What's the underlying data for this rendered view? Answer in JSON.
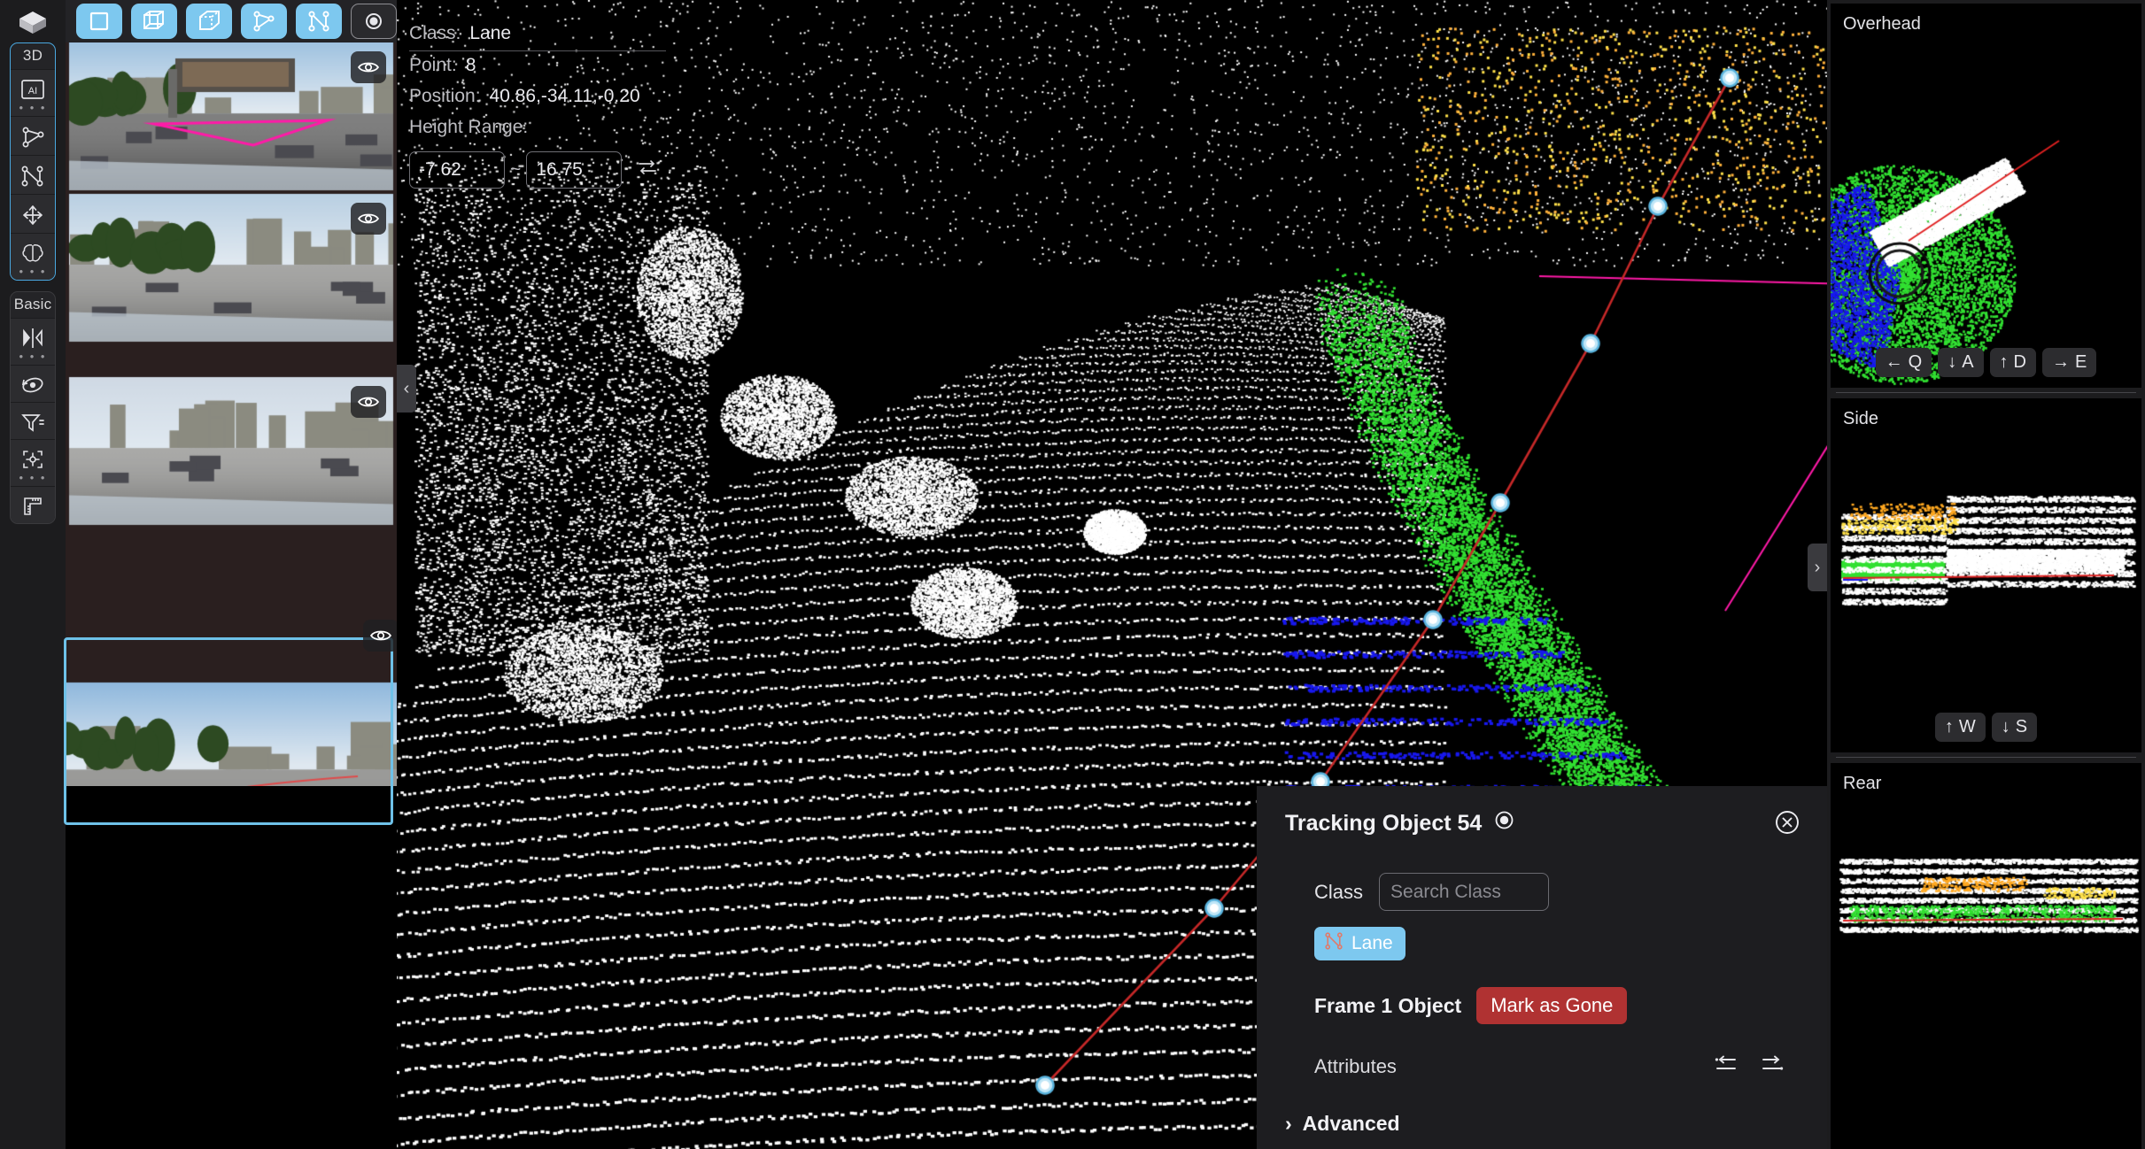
{
  "app": {
    "name": "3d-lidar-annotation-tool"
  },
  "rail": {
    "logo_icon": "cube-logo-icon",
    "groups": [
      {
        "header": "3D",
        "active": true,
        "items": [
          {
            "icon": "ai-box-icon",
            "name": "ai-tool",
            "more": true
          },
          {
            "icon": "polygon-icon",
            "name": "polygon-tool",
            "more": false
          },
          {
            "icon": "polyline-icon",
            "name": "polyline-tool",
            "more": false
          },
          {
            "icon": "move-icon",
            "name": "move-tool",
            "more": false
          },
          {
            "icon": "brain-icon",
            "name": "smart-tool",
            "more": true
          }
        ]
      },
      {
        "header": "Basic",
        "active": false,
        "items": [
          {
            "icon": "mirror-icon",
            "name": "mirror-tool",
            "more": true
          },
          {
            "icon": "rotate-icon",
            "name": "rotate-tool",
            "more": false
          },
          {
            "icon": "filter-icon",
            "name": "filter-tool",
            "more": false
          },
          {
            "icon": "crosshair-icon",
            "name": "focus-tool",
            "more": true
          },
          {
            "icon": "ruler-icon",
            "name": "measure-tool",
            "more": false
          }
        ]
      }
    ]
  },
  "toolbar": {
    "items": [
      {
        "icon": "rect-2d-icon",
        "name": "tool-rect-2d",
        "active": true
      },
      {
        "icon": "cuboid-icon",
        "name": "tool-cuboid",
        "active": true
      },
      {
        "icon": "cuboid-solid-icon",
        "name": "tool-cuboid-solid",
        "active": true
      },
      {
        "icon": "polygon-icon",
        "name": "tool-polygon",
        "active": true
      },
      {
        "icon": "polyline-icon",
        "name": "tool-polyline",
        "active": true
      },
      {
        "icon": "point-icon",
        "name": "tool-point",
        "active": false
      }
    ]
  },
  "cameras": [
    {
      "name": "camera-front",
      "eye_icon": "eye-icon",
      "selected": false
    },
    {
      "name": "camera-front-left",
      "eye_icon": "eye-icon",
      "selected": false
    },
    {
      "name": "camera-front-right",
      "eye_icon": "eye-icon",
      "selected": false
    },
    {
      "name": "camera-rear",
      "eye_icon": "eye-icon",
      "selected": true
    }
  ],
  "info": {
    "class_label": "Class:",
    "class_value": "Lane",
    "point_label": "Point:",
    "point_value": "8",
    "position_label": "Position:",
    "position_value": "40.86,-34.11,-0.20",
    "height_range_label": "Height Range:",
    "height_min": "-7.62",
    "height_max": "16.75",
    "range_separator": "~",
    "swap_icon": "swap-range-icon"
  },
  "handles": {
    "left_icon": "chevron-left-icon",
    "left_glyph": "‹",
    "right_icon": "chevron-right-icon",
    "right_glyph": "›"
  },
  "tracking_panel": {
    "title": "Tracking Object 54",
    "visibility_icon": "eye-target-icon",
    "close_icon": "close-icon",
    "class_label": "Class",
    "class_placeholder": "Search Class",
    "class_value": "",
    "chip_label": "Lane",
    "chip_icon": "polyline-icon",
    "chip_color": "#7dc8ef",
    "frame_label": "Frame 1 Object",
    "mark_gone_label": "Mark as Gone",
    "mark_gone_color": "#b03232",
    "attributes_label": "Attributes",
    "attr_prev_icon": "collapse-left-icon",
    "attr_next_icon": "expand-right-icon",
    "advanced_label": "Advanced",
    "advanced_chevron": "›"
  },
  "right_panel": {
    "views": [
      {
        "title": "Overhead",
        "name": "overhead-view",
        "keys": [
          {
            "arrow": "←",
            "label": "Q",
            "name": "key-q"
          },
          {
            "arrow": "↓",
            "label": "A",
            "name": "key-a"
          },
          {
            "arrow": "↑",
            "label": "D",
            "name": "key-d"
          },
          {
            "arrow": "→",
            "label": "E",
            "name": "key-e"
          }
        ]
      },
      {
        "title": "Side",
        "name": "side-view",
        "keys": [
          {
            "arrow": "↑",
            "label": "W",
            "name": "key-w"
          },
          {
            "arrow": "↓",
            "label": "S",
            "name": "key-s"
          }
        ]
      },
      {
        "title": "Rear",
        "name": "rear-view",
        "keys": []
      }
    ]
  },
  "colors": {
    "accent": "#7dc8ef",
    "danger": "#b03232",
    "panel_bg": "#1d1d20",
    "rail_bg": "#1c1c1e",
    "lane_line": "#c62828",
    "vertex": "#bfe6f7",
    "ground_green": "#32e032",
    "ground_blue": "#1818ee",
    "pointcloud_white": "#ffffff",
    "pink_overlay": "#ff1aa8"
  }
}
